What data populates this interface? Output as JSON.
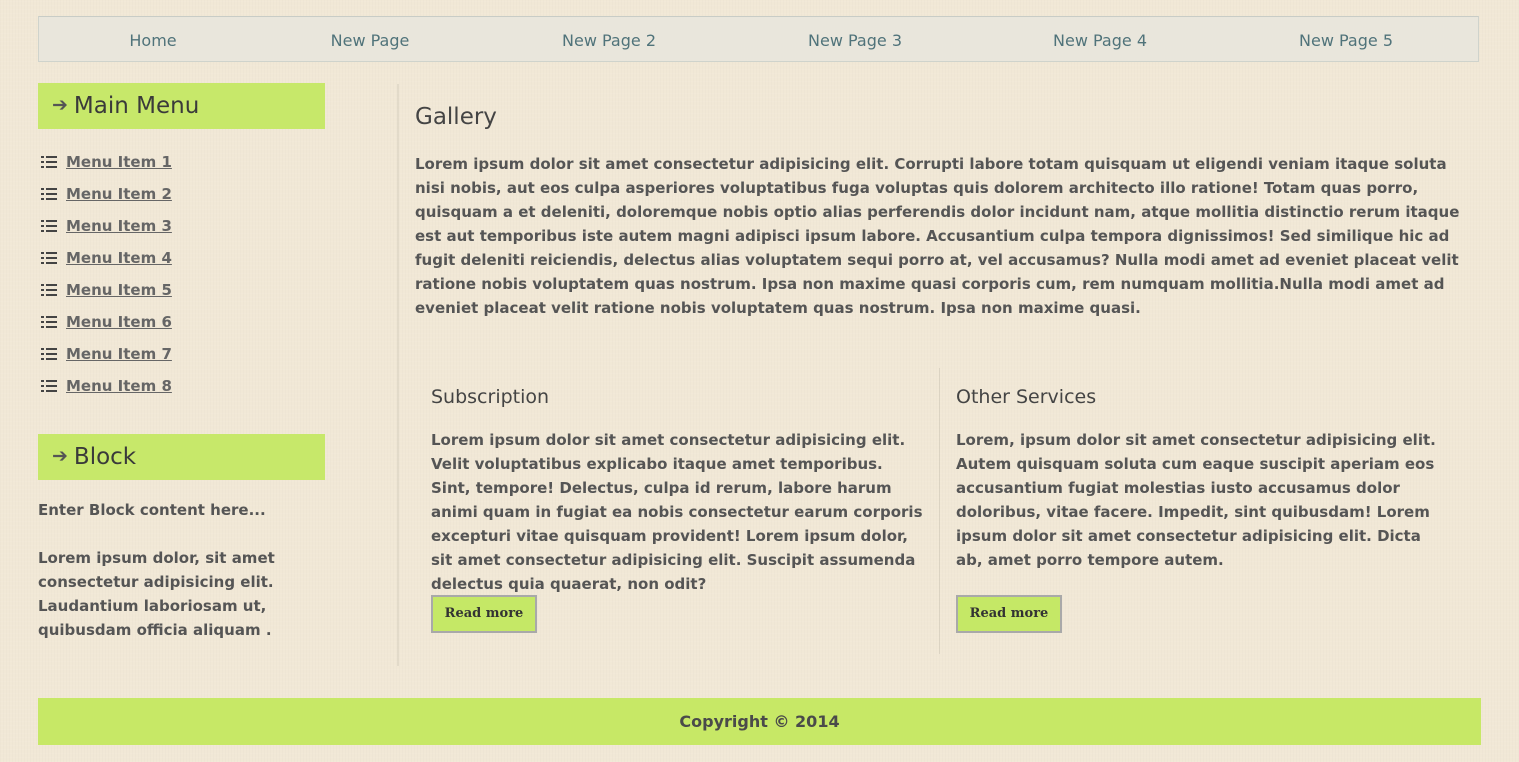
{
  "nav": {
    "items": [
      {
        "label": "Home"
      },
      {
        "label": "New Page"
      },
      {
        "label": "New Page 2"
      },
      {
        "label": "New Page 3"
      },
      {
        "label": "New Page 4"
      },
      {
        "label": "New Page 5"
      }
    ]
  },
  "sidebar": {
    "main_menu": {
      "title": "Main Menu",
      "icon": "arrow-right-icon",
      "items": [
        {
          "label": "Menu Item 1",
          "icon": "list-icon"
        },
        {
          "label": "Menu Item 2",
          "icon": "list-icon"
        },
        {
          "label": "Menu Item 3",
          "icon": "list-icon"
        },
        {
          "label": "Menu Item 4",
          "icon": "list-icon"
        },
        {
          "label": "Menu Item 5",
          "icon": "list-icon"
        },
        {
          "label": "Menu Item 6",
          "icon": "list-icon"
        },
        {
          "label": "Menu Item 7",
          "icon": "list-icon"
        },
        {
          "label": "Menu Item 8",
          "icon": "list-icon"
        }
      ]
    },
    "block": {
      "title": "Block",
      "icon": "arrow-right-icon",
      "content_line1": "Enter Block content here...",
      "content_line2": "Lorem ipsum dolor, sit amet consectetur adipisicing elit. Laudantium laboriosam ut, quibusdam officia aliquam ."
    }
  },
  "main": {
    "title": "Gallery",
    "lead": "Lorem ipsum dolor sit amet consectetur adipisicing elit. Corrupti labore totam quisquam ut eligendi veniam itaque soluta nisi nobis, aut eos culpa asperiores voluptatibus fuga voluptas quis dolorem architecto illo ratione! Totam quas porro, quisquam a et deleniti, doloremque nobis optio alias perferendis dolor incidunt nam, atque mollitia distinctio rerum itaque est aut temporibus iste autem magni adipisci ipsum labore. Accusantium culpa tempora dignissimos! Sed similique hic ad fugit deleniti reiciendis, delectus alias voluptatem sequi porro at, vel accusamus? Nulla modi amet ad eveniet placeat velit ratione nobis voluptatem quas nostrum. Ipsa non maxime quasi corporis cum, rem numquam mollitia.Nulla modi amet ad eveniet placeat velit ratione nobis voluptatem quas nostrum. Ipsa non maxime quasi.",
    "columns": [
      {
        "title": "Subscription",
        "text": "Lorem ipsum dolor sit amet consectetur adipisicing elit. Velit voluptatibus explicabo itaque amet temporibus. Sint, tempore! Delectus, culpa id rerum, labore harum animi quam in fugiat ea nobis consectetur earum corporis excepturi vitae quisquam provident! Lorem ipsum dolor, sit amet consectetur adipisicing elit. Suscipit assumenda delectus quia quaerat, non odit?",
        "button": "Read more"
      },
      {
        "title": "Other Services",
        "text": "Lorem, ipsum dolor sit amet consectetur adipisicing elit. Autem quisquam soluta cum eaque suscipit aperiam eos accusantium fugiat molestias iusto accusamus dolor doloribus, vitae facere. Impedit, sint quibusdam! Lorem ipsum dolor sit amet consectetur adipisicing elit. Dicta ab, amet porro tempore autem.",
        "button": "Read more"
      }
    ]
  },
  "footer": {
    "copyright": "Copyright © 2014"
  },
  "colors": {
    "background": "#f1e8d6",
    "accent_green": "#c7e86a",
    "nav_link": "#50737a",
    "nav_bg": "#e9e6dc"
  }
}
